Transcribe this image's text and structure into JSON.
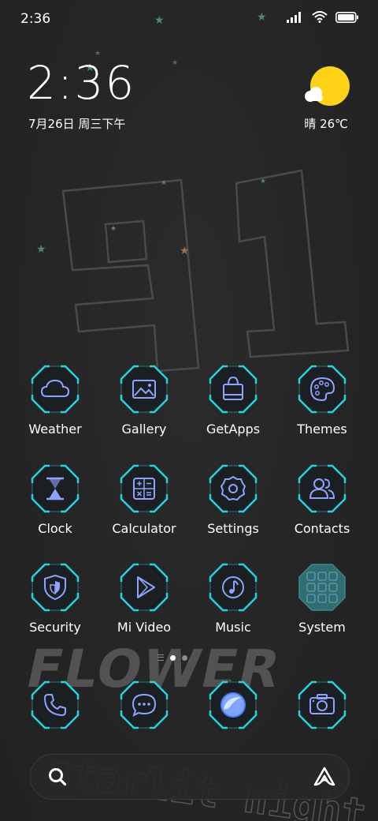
{
  "status_bar": {
    "time": "2:36",
    "icons": [
      "signal-icon",
      "wifi-icon",
      "battery-icon"
    ]
  },
  "clock_widget": {
    "time": "2:36",
    "date": "7月26日 周三下午"
  },
  "weather_widget": {
    "condition_icon": "sun-cloud-icon",
    "summary": "晴 26℃"
  },
  "wallpaper": {
    "number_text": "91",
    "flower_text": "FLOWER",
    "tagline_text": "starlit night"
  },
  "apps": [
    {
      "label": "Weather",
      "icon": "cloud-icon"
    },
    {
      "label": "Gallery",
      "icon": "image-icon"
    },
    {
      "label": "GetApps",
      "icon": "shopping-bag-icon"
    },
    {
      "label": "Themes",
      "icon": "palette-icon"
    },
    {
      "label": "Clock",
      "icon": "hourglass-icon"
    },
    {
      "label": "Calculator",
      "icon": "calculator-icon"
    },
    {
      "label": "Settings",
      "icon": "gear-icon"
    },
    {
      "label": "Contacts",
      "icon": "contacts-icon"
    },
    {
      "label": "Security",
      "icon": "shield-icon"
    },
    {
      "label": "Mi Video",
      "icon": "play-icon"
    },
    {
      "label": "Music",
      "icon": "music-note-icon"
    },
    {
      "label": "System",
      "icon": "folder-grid-icon"
    }
  ],
  "dock": [
    {
      "icon": "phone-icon"
    },
    {
      "icon": "chat-bubble-icon"
    },
    {
      "icon": "browser-icon"
    },
    {
      "icon": "camera-icon"
    }
  ],
  "pagination": {
    "pages": 2,
    "active_page": 1
  },
  "search_bar": {
    "left_icon": "search-icon",
    "right_icon": "assistant-icon"
  },
  "colors": {
    "background": "#262626",
    "icon_frame_accent": "#22d3e0",
    "icon_glyph": "#8ea2ff",
    "sun": "#ffd21a"
  }
}
